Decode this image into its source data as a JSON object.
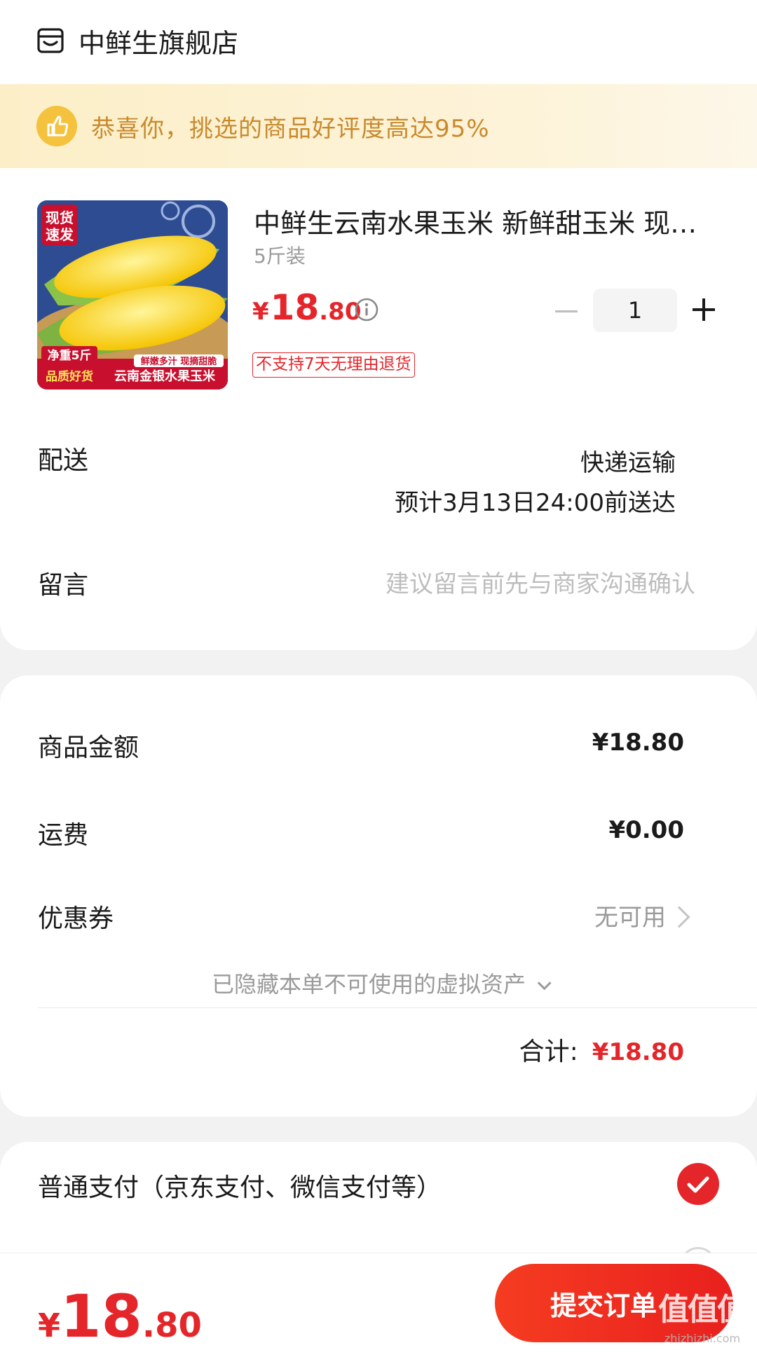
{
  "shop": {
    "name": "中鲜生旗舰店"
  },
  "banner": {
    "text": "恭喜你，挑选的商品好评度高达95%"
  },
  "product": {
    "title": "中鲜生云南水果玉米 新鲜甜玉米 现货速发",
    "spec": "5斤装",
    "price": {
      "symbol": "¥",
      "int": "18",
      "dec": ".80"
    },
    "quantity": "1",
    "return_tag": "不支持7天无理由退货",
    "image": {
      "badge_top": "现货速发",
      "net_weight": "净重5斤",
      "slogan": "鲜嫩多汁 现摘甜脆",
      "quality": "品质好货",
      "name": "云南金银水果玉米"
    }
  },
  "delivery": {
    "label": "配送",
    "method": "快递运输",
    "eta": "预计3月13日24:00前送达"
  },
  "message": {
    "label": "留言",
    "placeholder": "建议留言前先与商家沟通确认"
  },
  "amounts": {
    "goods_label": "商品金额",
    "goods_value": "¥18.80",
    "shipping_label": "运费",
    "shipping_value": "¥0.00",
    "coupon_label": "优惠券",
    "coupon_value": "无可用",
    "hidden_assets": "已隐藏本单不可使用的虚拟资产",
    "total_label": "合计:",
    "total_value": "¥18.80"
  },
  "payment": {
    "option_label": "普通支付（京东支付、微信支付等）"
  },
  "bottom": {
    "price": {
      "symbol": "¥",
      "int": "18",
      "dec": ".80"
    },
    "submit_label": "提交订单"
  },
  "watermark": {
    "big": "值值值",
    "small": "zhizhizhi.com"
  },
  "colors": {
    "accent_red": "#e4262b",
    "banner_text": "#c98a2d",
    "banner_bg": "#fcefc8"
  }
}
